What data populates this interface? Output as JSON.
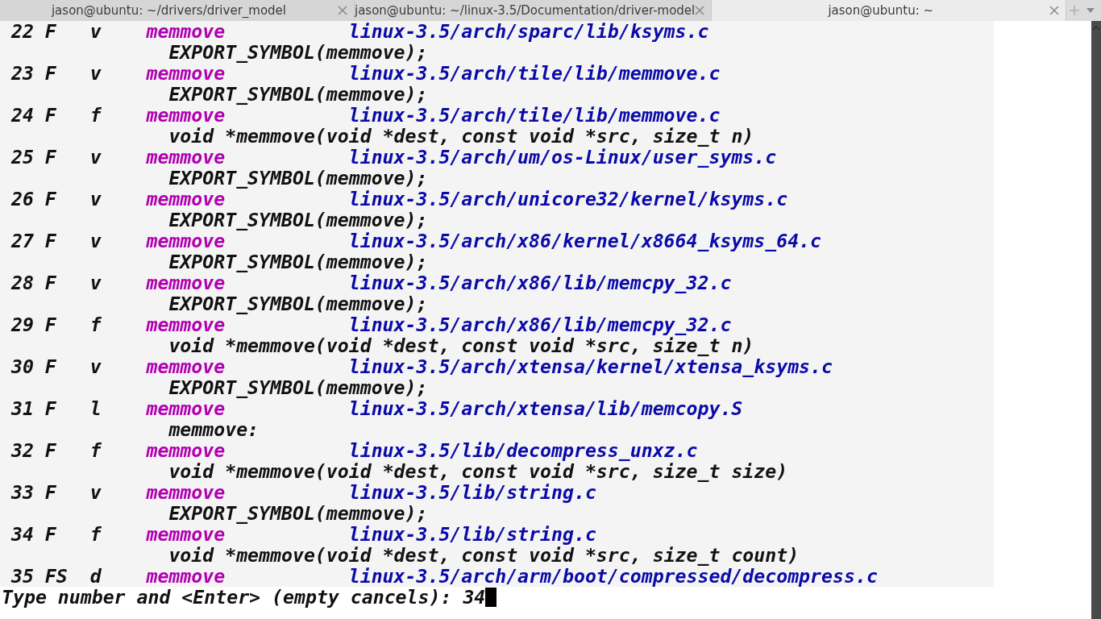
{
  "tabs": [
    {
      "title": "jason@ubuntu: ~/drivers/driver_model",
      "selected": false
    },
    {
      "title": "jason@ubuntu: ~/linux-3.5/Documentation/driver-model",
      "selected": false
    },
    {
      "title": "jason@ubuntu: ~",
      "selected": true
    }
  ],
  "rows": [
    {
      "number": "22",
      "flags": "F",
      "kind": "v",
      "symbol": "memmove",
      "file": "linux-3.5/arch/sparc/lib/ksyms.c",
      "context": "EXPORT_SYMBOL(memmove);"
    },
    {
      "number": "23",
      "flags": "F",
      "kind": "v",
      "symbol": "memmove",
      "file": "linux-3.5/arch/tile/lib/memmove.c",
      "context": "EXPORT_SYMBOL(memmove);"
    },
    {
      "number": "24",
      "flags": "F",
      "kind": "f",
      "symbol": "memmove",
      "file": "linux-3.5/arch/tile/lib/memmove.c",
      "context": "void *memmove(void *dest, const void *src, size_t n)"
    },
    {
      "number": "25",
      "flags": "F",
      "kind": "v",
      "symbol": "memmove",
      "file": "linux-3.5/arch/um/os-Linux/user_syms.c",
      "context": "EXPORT_SYMBOL(memmove);"
    },
    {
      "number": "26",
      "flags": "F",
      "kind": "v",
      "symbol": "memmove",
      "file": "linux-3.5/arch/unicore32/kernel/ksyms.c",
      "context": "EXPORT_SYMBOL(memmove);"
    },
    {
      "number": "27",
      "flags": "F",
      "kind": "v",
      "symbol": "memmove",
      "file": "linux-3.5/arch/x86/kernel/x8664_ksyms_64.c",
      "context": "EXPORT_SYMBOL(memmove);"
    },
    {
      "number": "28",
      "flags": "F",
      "kind": "v",
      "symbol": "memmove",
      "file": "linux-3.5/arch/x86/lib/memcpy_32.c",
      "context": "EXPORT_SYMBOL(memmove);"
    },
    {
      "number": "29",
      "flags": "F",
      "kind": "f",
      "symbol": "memmove",
      "file": "linux-3.5/arch/x86/lib/memcpy_32.c",
      "context": "void *memmove(void *dest, const void *src, size_t n)"
    },
    {
      "number": "30",
      "flags": "F",
      "kind": "v",
      "symbol": "memmove",
      "file": "linux-3.5/arch/xtensa/kernel/xtensa_ksyms.c",
      "context": "EXPORT_SYMBOL(memmove);"
    },
    {
      "number": "31",
      "flags": "F",
      "kind": "l",
      "symbol": "memmove",
      "file": "linux-3.5/arch/xtensa/lib/memcopy.S",
      "context": "memmove:"
    },
    {
      "number": "32",
      "flags": "F",
      "kind": "f",
      "symbol": "memmove",
      "file": "linux-3.5/lib/decompress_unxz.c",
      "context": "void *memmove(void *dest, const void *src, size_t size)"
    },
    {
      "number": "33",
      "flags": "F",
      "kind": "v",
      "symbol": "memmove",
      "file": "linux-3.5/lib/string.c",
      "context": "EXPORT_SYMBOL(memmove);"
    },
    {
      "number": "34",
      "flags": "F",
      "kind": "f",
      "symbol": "memmove",
      "file": "linux-3.5/lib/string.c",
      "context": "void *memmove(void *dest, const void *src, size_t count)"
    },
    {
      "number": "35",
      "flags": "FS",
      "kind": "d",
      "symbol": "memmove",
      "file": "linux-3.5/arch/arm/boot/compressed/decompress.c"
    }
  ],
  "prompt": {
    "label": "Type number and <Enter> (empty cancels):",
    "value": "34"
  }
}
